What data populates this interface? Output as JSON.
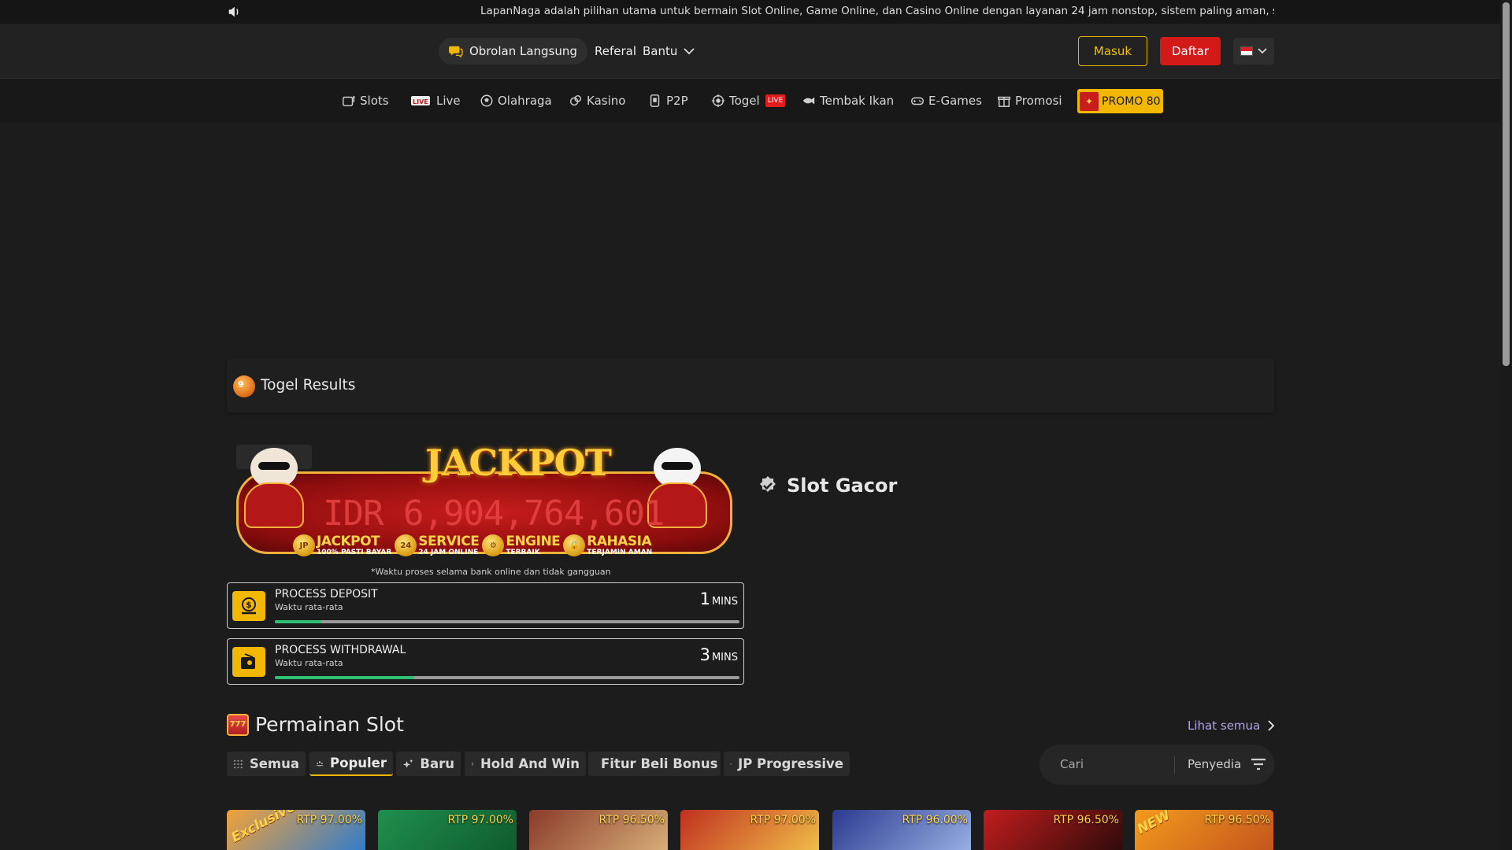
{
  "ticker": {
    "message": "LapanNaga adalah pilihan utama untuk bermain Slot Online, Game Online, dan Casino Online dengan layanan 24 jam nonstop, sistem paling aman, serta link akses mu"
  },
  "header": {
    "chat_label": "Obrolan Langsung",
    "referral_label": "Referal",
    "help_label": "Bantu",
    "login_label": "Masuk",
    "register_label": "Daftar"
  },
  "nav": {
    "items": [
      {
        "label": "Slots",
        "icon": "slot-machine-icon"
      },
      {
        "label": "Live",
        "icon": "live-icon"
      },
      {
        "label": "Olahraga",
        "icon": "soccer-ball-icon"
      },
      {
        "label": "Kasino",
        "icon": "casino-chips-icon"
      },
      {
        "label": "P2P",
        "icon": "p2p-icon"
      },
      {
        "label": "Togel",
        "icon": "lottery-ball-icon",
        "badge": "LIVE"
      },
      {
        "label": "Tembak Ikan",
        "icon": "fish-icon"
      },
      {
        "label": "E-Games",
        "icon": "gamepad-icon"
      },
      {
        "label": "Promosi",
        "icon": "gift-icon"
      }
    ],
    "promo_label": "PROMO 80"
  },
  "togel": {
    "title": "Togel Results"
  },
  "jackpot": {
    "title": "JACKPOT",
    "amount": "IDR 6,904,764,601",
    "features": [
      {
        "badge": "JP",
        "title": "JACKPOT",
        "sub": "100% PASTI BAYAR"
      },
      {
        "badge": "24",
        "title": "SERVICE",
        "sub": "24 JAM ONLINE"
      },
      {
        "badge": "⚙",
        "title": "ENGINE",
        "sub": "TERBAIK"
      },
      {
        "badge": "🔒",
        "title": "RAHASIA",
        "sub": "TERJAMIN AMAN"
      }
    ],
    "note": "*Waktu proses selama bank online dan tidak gangguan"
  },
  "process": {
    "deposit": {
      "title": "PROCESS DEPOSIT",
      "sub": "Waktu rata-rata",
      "value": "1",
      "unit": "MINS",
      "progress": 0.1
    },
    "withdrawal": {
      "title": "PROCESS WITHDRAWAL",
      "sub": "Waktu rata-rata",
      "value": "3",
      "unit": "MINS",
      "progress": 0.3
    }
  },
  "slot_gacor": {
    "title": "Slot Gacor"
  },
  "permainan": {
    "title": "Permainan Slot",
    "see_all": "Lihat semua",
    "categories": [
      {
        "label": "Semua",
        "icon": "grid-icon"
      },
      {
        "label": "Populer",
        "icon": "popular-icon"
      },
      {
        "label": "Baru",
        "icon": "sparkle-icon"
      },
      {
        "label": "Hold And Win",
        "icon": "trophy-icon"
      },
      {
        "label": "Fitur Beli Bonus",
        "icon": "bonus-icon"
      },
      {
        "label": "JP Progressive",
        "icon": "progressive-icon"
      }
    ],
    "search_placeholder": "Cari",
    "provider_label": "Penyedia",
    "games": [
      {
        "rtp": "RTP 97.00%",
        "tag": "Exclusive",
        "color_a": "#f2a23a",
        "color_b": "#2b7bd1"
      },
      {
        "rtp": "RTP 97.00%",
        "tag": "",
        "color_a": "#1f8f4e",
        "color_b": "#0f5a2c"
      },
      {
        "rtp": "RTP 96.50%",
        "tag": "",
        "color_a": "#8a3b2a",
        "color_b": "#d9b27a"
      },
      {
        "rtp": "RTP 97.00%",
        "tag": "",
        "color_a": "#c0301f",
        "color_b": "#f2c24a"
      },
      {
        "rtp": "RTP 96.00%",
        "tag": "",
        "color_a": "#2b3a8f",
        "color_b": "#9bb4e6"
      },
      {
        "rtp": "RTP 96.50%",
        "tag": "",
        "color_a": "#c21d1d",
        "color_b": "#2a0a0a"
      },
      {
        "rtp": "RTP 96.50%",
        "tag": "NEW",
        "color_a": "#f29a1d",
        "color_b": "#c2531d"
      }
    ]
  },
  "colors": {
    "accent_yellow": "#f2b700",
    "register_red": "#d41919",
    "progress_green": "#2fbf71",
    "link_purple": "#b7a4e6"
  }
}
